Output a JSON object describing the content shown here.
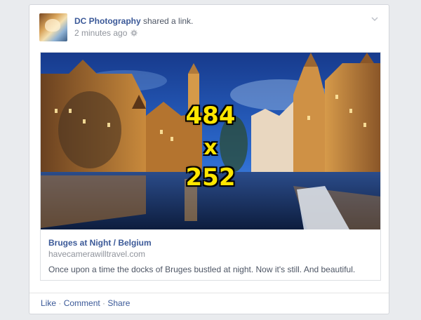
{
  "post": {
    "author": "DC Photography",
    "action": " shared a link.",
    "timestamp": "2 minutes ago",
    "privacy_icon": "gear-icon",
    "menu_icon": "chevron-down-icon"
  },
  "link": {
    "image_overlay": {
      "width": "484",
      "by": "x",
      "height": "252"
    },
    "title": "Bruges at Night / Belgium",
    "domain": "havecamerawilltravel.com",
    "description": "Once upon a time the docks of Bruges bustled at night. Now it's still. And beautiful."
  },
  "actions": {
    "like": "Like",
    "comment": "Comment",
    "share": "Share",
    "separator": " · "
  },
  "colors": {
    "link_blue": "#3b5998",
    "overlay_yellow": "#ffe600",
    "sky": "#1f4fa6"
  }
}
